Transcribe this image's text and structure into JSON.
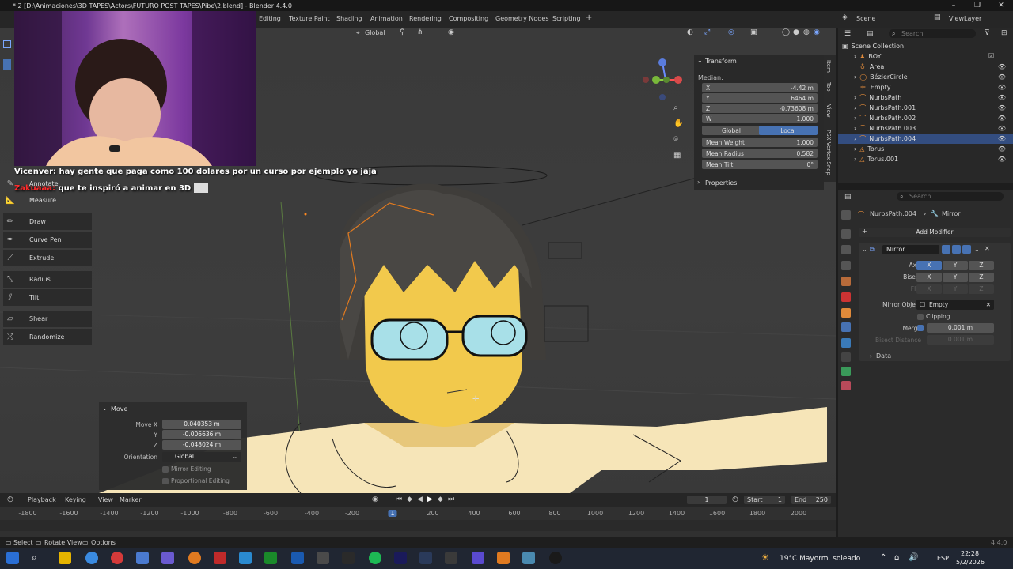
{
  "window": {
    "title": "* 2 [D:\\Animaciones\\3D TAPES\\Actors\\FUTURO POST TAPES\\Pibe\\2.blend] - Blender 4.4.0"
  },
  "workspaces": [
    "Editing",
    "Texture Paint",
    "Shading",
    "Animation",
    "Rendering",
    "Compositing",
    "Geometry Nodes",
    "Scripting",
    "+"
  ],
  "scene_selector": {
    "scene": "Scene",
    "view_layer": "ViewLayer"
  },
  "viewport_header": {
    "orientation": "Global"
  },
  "chat": [
    {
      "user": "Vicenver:",
      "message": "hay gente que paga como 100 dolares por un curso por ejemplo yo jaja",
      "user_color": "#ffffff"
    },
    {
      "user": "Zakuaaa:",
      "message": "que te inspiró a animar en 3D",
      "user_color": "#ff2a2a"
    }
  ],
  "tools": [
    "Annotate",
    "Measure",
    "Draw",
    "Curve Pen",
    "Extrude",
    "Radius",
    "Tilt",
    "Shear",
    "Randomize"
  ],
  "npanel": {
    "header": "Transform",
    "median_label": "Median:",
    "fields": [
      {
        "label": "X",
        "value": "-4.42 m"
      },
      {
        "label": "Y",
        "value": "1.6464 m"
      },
      {
        "label": "Z",
        "value": "-0.73608 m"
      },
      {
        "label": "W",
        "value": "1.000"
      }
    ],
    "space": {
      "global": "Global",
      "local": "Local"
    },
    "extras": [
      {
        "label": "Mean Weight",
        "value": "1.000"
      },
      {
        "label": "Mean Radius",
        "value": "0.582"
      },
      {
        "label": "Mean Tilt",
        "value": "0°"
      }
    ],
    "properties_header": "Properties",
    "side_tabs": [
      "Item",
      "Tool",
      "View",
      "PSX Vertex Snap"
    ]
  },
  "move_panel": {
    "title": "Move",
    "move_x_label": "Move X",
    "move_x": "0.040353 m",
    "y_label": "Y",
    "y": "-0.006636 m",
    "z_label": "Z",
    "z": "-0.048024 m",
    "orientation_label": "Orientation",
    "orientation": "Global",
    "mirror_editing": "Mirror Editing",
    "proportional_editing": "Proportional Editing"
  },
  "timeline": {
    "menus": [
      "Playback",
      "Keying",
      "View",
      "Marker"
    ],
    "current_frame": "1",
    "start_label": "Start",
    "start": "1",
    "end_label": "End",
    "end": "250",
    "ticks": [
      "-1800",
      "-1600",
      "-1400",
      "-1200",
      "-1000",
      "-800",
      "-600",
      "-400",
      "-200",
      "1",
      "200",
      "400",
      "600",
      "800",
      "1000",
      "1200",
      "1400",
      "1600",
      "1800",
      "2000"
    ]
  },
  "statusbar": {
    "select": "Select",
    "rotate_view": "Rotate View",
    "options": "Options",
    "version": "4.4.0"
  },
  "outliner": {
    "search_placeholder": "Search",
    "root": "Scene Collection",
    "items": [
      "BOY",
      "Area",
      "BézierCircle",
      "Empty",
      "NurbsPath",
      "NurbsPath.001",
      "NurbsPath.002",
      "NurbsPath.003",
      "NurbsPath.004",
      "Torus",
      "Torus.001"
    ],
    "selected": "NurbsPath.004"
  },
  "properties": {
    "search_placeholder": "Search",
    "breadcrumb_object": "NurbsPath.004",
    "breadcrumb_modifier": "Mirror",
    "add_modifier": "Add Modifier",
    "modifier_name": "Mirror",
    "axis_label": "Axis",
    "bisect_label": "Bisect",
    "flip_label": "Flip",
    "x": "X",
    "y": "Y",
    "z": "Z",
    "mirror_object_label": "Mirror Object",
    "mirror_object": "Empty",
    "clipping": "Clipping",
    "merge_label": "Merge",
    "merge_value": "0.001 m",
    "bisect_distance_label": "Bisect Distance",
    "bisect_distance": "0.001 m",
    "data": "Data"
  },
  "taskbar": {
    "weather": "19°C  Mayorm. soleado",
    "lang": "ESP",
    "time": "22:28",
    "date": "5/2/2026"
  },
  "colors": {
    "accent": "#4772b3",
    "selected_row": "#334d80",
    "hair": "#454442",
    "skin": "#f2c94c",
    "lens": "#a8e0e8"
  }
}
